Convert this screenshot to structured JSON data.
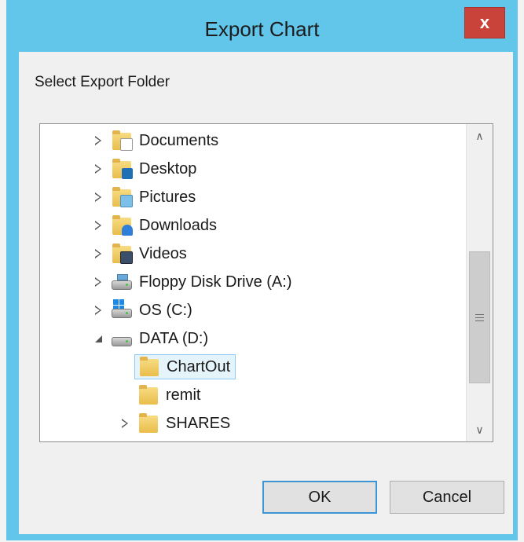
{
  "dialog": {
    "title": "Export Chart",
    "close_glyph": "x",
    "prompt": "Select Export Folder"
  },
  "tree": {
    "items": [
      {
        "label": "Documents",
        "icon": "documents-folder-icon",
        "state": "collapsed",
        "level": 0
      },
      {
        "label": "Desktop",
        "icon": "desktop-folder-icon",
        "state": "collapsed",
        "level": 0
      },
      {
        "label": "Pictures",
        "icon": "pictures-folder-icon",
        "state": "collapsed",
        "level": 0
      },
      {
        "label": "Downloads",
        "icon": "downloads-folder-icon",
        "state": "collapsed",
        "level": 0
      },
      {
        "label": "Videos",
        "icon": "videos-folder-icon",
        "state": "collapsed",
        "level": 0
      },
      {
        "label": "Floppy Disk Drive (A:)",
        "icon": "floppy-drive-icon",
        "state": "collapsed",
        "level": 0
      },
      {
        "label": "OS (C:)",
        "icon": "system-drive-icon",
        "state": "collapsed",
        "level": 0
      },
      {
        "label": "DATA (D:)",
        "icon": "hard-drive-icon",
        "state": "expanded",
        "level": 0
      },
      {
        "label": "ChartOut",
        "icon": "folder-icon",
        "state": "none",
        "level": 1,
        "selected": true
      },
      {
        "label": "remit",
        "icon": "folder-icon",
        "state": "none",
        "level": 1
      },
      {
        "label": "SHARES",
        "icon": "folder-icon",
        "state": "collapsed",
        "level": 1
      }
    ]
  },
  "buttons": {
    "ok": "OK",
    "cancel": "Cancel"
  },
  "colors": {
    "frame": "#62c5ea",
    "close": "#c9433b",
    "selection": "#e5f3fb"
  }
}
